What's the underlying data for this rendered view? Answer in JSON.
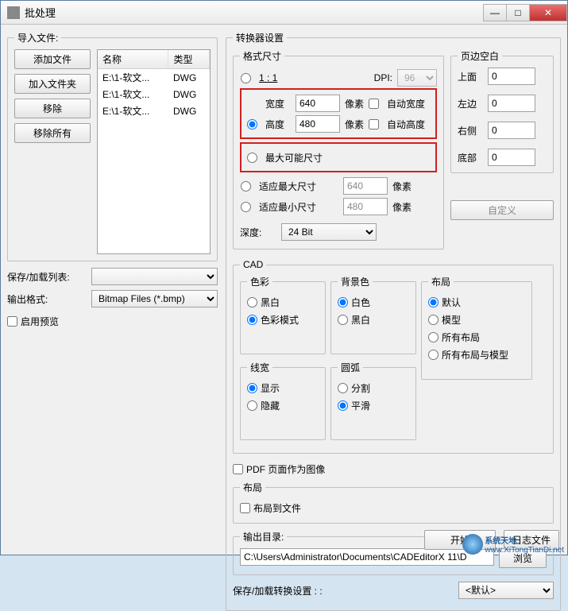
{
  "window": {
    "title": "批处理"
  },
  "import": {
    "legend": "导入文件:",
    "add_file": "添加文件",
    "add_folder": "加入文件夹",
    "remove": "移除",
    "remove_all": "移除所有",
    "cols": {
      "name": "名称",
      "type": "类型"
    },
    "rows": [
      {
        "name": "E:\\1-软文...",
        "type": "DWG"
      },
      {
        "name": "E:\\1-软文...",
        "type": "DWG"
      },
      {
        "name": "E:\\1-软文...",
        "type": "DWG"
      }
    ]
  },
  "saveload_list_label": "保存/加载列表:",
  "output_format_label": "输出格式:",
  "output_format_value": "Bitmap Files (*.bmp)",
  "enable_preview": "启用预览",
  "converter": {
    "legend": "转换器设置",
    "format_size_legend": "格式尺寸",
    "one_to_one": "1 : 1",
    "dpi_label": "DPI:",
    "dpi_value": "96",
    "width_label": "宽度",
    "width_value": "640",
    "height_label": "高度",
    "height_value": "480",
    "pixel": "像素",
    "auto_width": "自动宽度",
    "auto_height": "自动高度",
    "max_possible": "最大可能尺寸",
    "fit_max": "适应最大尺寸",
    "fit_max_value": "640",
    "fit_min": "适应最小尺寸",
    "fit_min_value": "480",
    "depth_label": "深度:",
    "depth_value": "24 Bit",
    "margins_legend": "页边空白",
    "margins": {
      "top_label": "上面",
      "left_label": "左边",
      "right_label": "右侧",
      "bottom_label": "底部",
      "top": "0",
      "left": "0",
      "right": "0",
      "bottom": "0"
    },
    "custom_btn": "自定义"
  },
  "cad": {
    "legend": "CAD",
    "color_legend": "色彩",
    "bw": "黑白",
    "color_mode": "色彩模式",
    "bgcolor_legend": "背景色",
    "white": "白色",
    "black": "黑白",
    "layout_legend": "布局",
    "layout_default": "默认",
    "layout_model": "模型",
    "layout_all": "所有布局",
    "layout_all_model": "所有布局与模型",
    "linewidth_legend": "线宽",
    "show": "显示",
    "hide": "隐藏",
    "arc_legend": "圆弧",
    "split": "分割",
    "smooth": "平滑"
  },
  "pdf_as_image": "PDF 页面作为图像",
  "layout_section_legend": "布局",
  "layout_to_file": "布局到文件",
  "output_dir_label": "输出目录:",
  "output_dir_value": "C:\\Users\\Administrator\\Documents\\CADEditorX 11\\D",
  "browse": "浏览",
  "saveload_convert_label": "保存/加载转换设置 : :",
  "saveload_convert_value": "<默认>",
  "start_btn": "开始",
  "log_file_btn": "日志文件",
  "watermark": {
    "brand": "系统天地",
    "url": "www.XiTongTianDi.net"
  }
}
